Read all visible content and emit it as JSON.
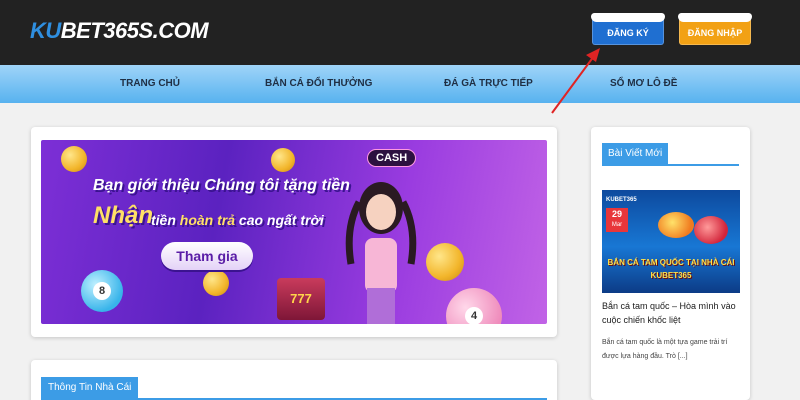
{
  "header": {
    "logo_prefix": "KU",
    "logo_rest": "BET365S.COM",
    "register_label": "ĐĂNG KÝ",
    "login_label": "ĐĂNG NHẬP"
  },
  "nav": {
    "items": [
      {
        "label": "TRANG CHỦ"
      },
      {
        "label": "BẮN CÁ ĐỔI THƯỞNG"
      },
      {
        "label": "ĐÁ GÀ TRỰC TIẾP"
      },
      {
        "label": "SỔ MƠ LÔ ĐỀ"
      }
    ]
  },
  "banner": {
    "line1": "Bạn giới thiệu  Chúng tôi tặng tiền",
    "line2_big": "Nhận",
    "line2_pre": "tiền ",
    "line2_highlight": "hoàn trả",
    "line2_post": " cao ngất trời",
    "cta_label": "Tham gia",
    "cash_tag": "CASH",
    "ball_left": "8",
    "ball_right": "4",
    "slot_text": "777"
  },
  "info": {
    "title": "Thông Tin Nhà Cái"
  },
  "sidebar": {
    "title": "Bài Viết Mới",
    "post": {
      "thumb_logo": "KUBET365",
      "thumb_day": "29",
      "thumb_month": "Mar",
      "thumb_caption_1": "BẮN CÁ TAM QUỐC TẠI NHÀ CÁI",
      "thumb_caption_2": "KUBET365",
      "title": "Bắn cá tam quốc – Hòa mình vào cuộc chiến khốc liệt",
      "excerpt": "Bắn cá tam quốc là một tựa game trải trí được lựa hàng đầu. Trò [...]"
    }
  },
  "colors": {
    "header_bg": "#222222",
    "register_btn": "#1f6fd1",
    "login_btn": "#f2a114",
    "accent_blue": "#3c9ce6",
    "annotation_arrow": "#e02424"
  }
}
